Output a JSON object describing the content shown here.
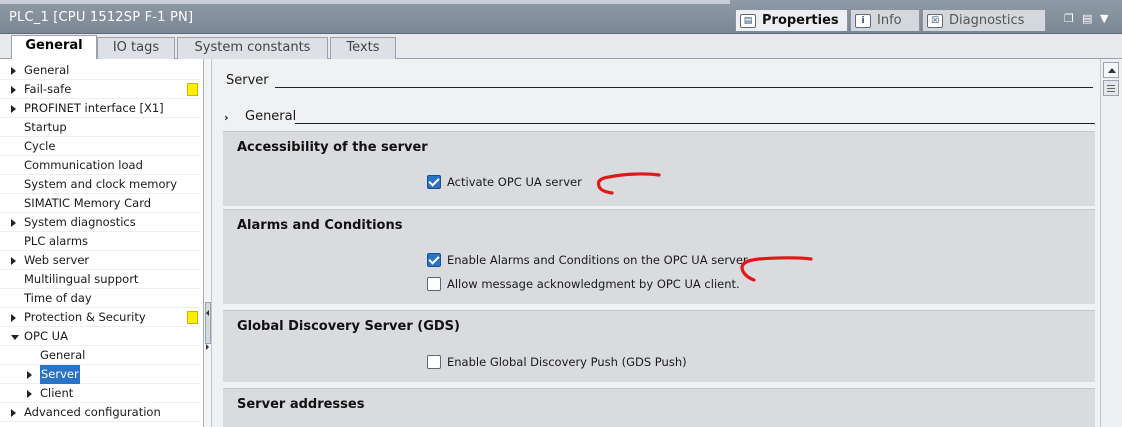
{
  "window": {
    "title": "PLC_1 [CPU 1512SP F-1 PN]"
  },
  "inspector_tabs": [
    {
      "label": "Properties",
      "icon": "properties-icon"
    },
    {
      "label": "Info",
      "icon": "info-icon"
    },
    {
      "label": "Diagnostics",
      "icon": "diagnostics-icon"
    }
  ],
  "tabs": [
    "General",
    "IO tags",
    "System constants",
    "Texts"
  ],
  "nav": {
    "items": [
      {
        "label": "General",
        "level": 0,
        "expander": "collapsed"
      },
      {
        "label": "Fail-safe",
        "level": 0,
        "expander": "collapsed",
        "flag": true
      },
      {
        "label": "PROFINET interface [X1]",
        "level": 0,
        "expander": "collapsed"
      },
      {
        "label": "Startup",
        "level": 0,
        "expander": "none"
      },
      {
        "label": "Cycle",
        "level": 0,
        "expander": "none"
      },
      {
        "label": "Communication load",
        "level": 0,
        "expander": "none"
      },
      {
        "label": "System and clock memory",
        "level": 0,
        "expander": "none"
      },
      {
        "label": "SIMATIC Memory Card",
        "level": 0,
        "expander": "none"
      },
      {
        "label": "System diagnostics",
        "level": 0,
        "expander": "collapsed"
      },
      {
        "label": "PLC alarms",
        "level": 0,
        "expander": "none"
      },
      {
        "label": "Web server",
        "level": 0,
        "expander": "collapsed"
      },
      {
        "label": "Multilingual support",
        "level": 0,
        "expander": "none"
      },
      {
        "label": "Time of day",
        "level": 0,
        "expander": "none"
      },
      {
        "label": "Protection & Security",
        "level": 0,
        "expander": "collapsed",
        "flag": true
      },
      {
        "label": "OPC UA",
        "level": 0,
        "expander": "expanded"
      },
      {
        "label": "General",
        "level": 1,
        "expander": "none"
      },
      {
        "label": "Server",
        "level": 1,
        "expander": "collapsed",
        "selected": true
      },
      {
        "label": "Client",
        "level": 1,
        "expander": "collapsed"
      },
      {
        "label": "Advanced configuration",
        "level": 0,
        "expander": "collapsed"
      }
    ]
  },
  "content": {
    "section_title": "Server",
    "subsection_title": "General",
    "panels": [
      {
        "heading": "Accessibility of the server",
        "options": [
          {
            "label": "Activate OPC UA server",
            "checked": true,
            "annotated": true
          }
        ]
      },
      {
        "heading": "Alarms and Conditions",
        "options": [
          {
            "label": "Enable Alarms and Conditions on the OPC UA server",
            "checked": true,
            "annotated": true
          },
          {
            "label": "Allow message acknowledgment by OPC UA client.",
            "checked": false
          }
        ]
      },
      {
        "heading": "Global Discovery Server (GDS)",
        "options": [
          {
            "label": "Enable Global Discovery Push (GDS Push)",
            "checked": false
          }
        ]
      },
      {
        "heading": "Server addresses",
        "options": []
      }
    ]
  },
  "colors": {
    "selection": "#2a74c7",
    "annotation": "#e01818",
    "flag": "#ffee00"
  }
}
